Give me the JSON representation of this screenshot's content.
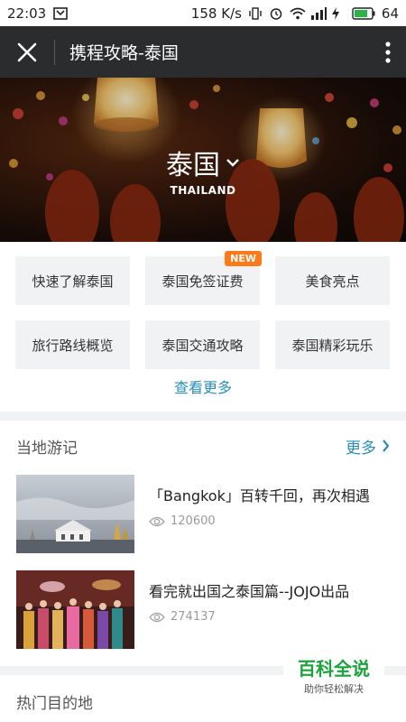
{
  "status_bar": {
    "time": "22:03",
    "speed": "158 K/s",
    "battery": "64"
  },
  "title_bar": {
    "title": "携程攻略-泰国"
  },
  "hero": {
    "title": "泰国",
    "subtitle": "THAILAND"
  },
  "grid": [
    {
      "label": "快速了解泰国",
      "badge": ""
    },
    {
      "label": "泰国免签证费",
      "badge": "NEW"
    },
    {
      "label": "美食亮点",
      "badge": ""
    },
    {
      "label": "旅行路线概览",
      "badge": ""
    },
    {
      "label": "泰国交通攻略",
      "badge": ""
    },
    {
      "label": "泰国精彩玩乐",
      "badge": ""
    }
  ],
  "view_more": "查看更多",
  "local_section": {
    "title": "当地游记",
    "more": "更多"
  },
  "articles": [
    {
      "title": "「Bangkok」百转千回，再次相遇",
      "views": "120600"
    },
    {
      "title": "看完就出国之泰国篇--JOJO出品",
      "views": "274137"
    }
  ],
  "hot_section": {
    "title": "热门目的地"
  },
  "watermark": {
    "main": "百科全说",
    "sub": "助你轻松解决"
  },
  "colors": {
    "accent": "#2a8fb4",
    "badge": "#ff7a1a",
    "title_bar": "#2b2c2e"
  }
}
